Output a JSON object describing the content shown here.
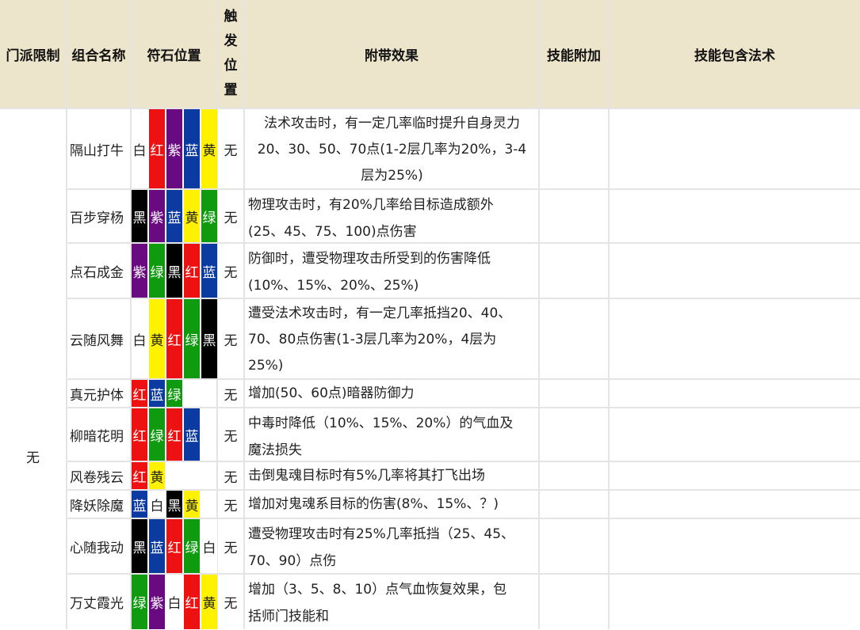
{
  "headers": {
    "school": "门派限制",
    "combo": "组合名称",
    "runes": "符石位置",
    "trigger": [
      "触",
      "发",
      "位",
      "置"
    ],
    "effect": "附带效果",
    "skill_add": "技能附加",
    "skill_spells": "技能包含法术"
  },
  "school_value": "无",
  "rune_colors": {
    "白": {
      "bg": "#ffffff",
      "fg": "#222222"
    },
    "红": {
      "bg": "#ee1111",
      "fg": "#ffffff"
    },
    "紫": {
      "bg": "#6a0a80",
      "fg": "#ffffff"
    },
    "蓝": {
      "bg": "#0b3aa0",
      "fg": "#ffffff"
    },
    "黄": {
      "bg": "#fff200",
      "fg": "#222222"
    },
    "黑": {
      "bg": "#000000",
      "fg": "#ffffff"
    },
    "绿": {
      "bg": "#109a10",
      "fg": "#ffffff"
    }
  },
  "rows": [
    {
      "name": "隔山打牛",
      "runes": [
        "白",
        "红",
        "紫",
        "蓝",
        "黄"
      ],
      "trigger": "无",
      "effect_lines": [
        "法术攻击时，有一定几率临时提升自身灵力",
        "20、30、50、70点(1-2层几率为20%，3-4",
        "层为25%)"
      ],
      "center": true
    },
    {
      "name": "百步穿杨",
      "runes": [
        "黑",
        "紫",
        "蓝",
        "黄",
        "绿"
      ],
      "trigger": "无",
      "effect_lines": [
        "物理攻击时，有20%几率给目标造成额外",
        "(25、45、75、100)点伤害"
      ]
    },
    {
      "name": "点石成金",
      "runes": [
        "紫",
        "绿",
        "黑",
        "红",
        "蓝"
      ],
      "trigger": "无",
      "effect_lines": [
        "防御时，遭受物理攻击所受到的伤害降低",
        "(10%、15%、20%、25%)"
      ]
    },
    {
      "name": "云随风舞",
      "runes": [
        "白",
        "黄",
        "红",
        "绿",
        "黑"
      ],
      "trigger": "无",
      "effect_lines": [
        "遭受法术攻击时，有一定几率抵挡20、40、",
        "70、80点伤害(1-3层几率为20%，4层为",
        "25%)"
      ]
    },
    {
      "name": "真元护体",
      "runes": [
        "红",
        "蓝",
        "绿"
      ],
      "trigger": "无",
      "effect_lines": [
        "增加(50、60点)暗器防御力"
      ]
    },
    {
      "name": "柳暗花明",
      "runes": [
        "红",
        "绿",
        "红",
        "蓝"
      ],
      "trigger": "无",
      "effect_lines": [
        "中毒时降低（10%、15%、20%）的气血及",
        "魔法损失"
      ]
    },
    {
      "name": "风卷残云",
      "runes": [
        "红",
        "黄"
      ],
      "trigger": "无",
      "effect_lines": [
        "击倒鬼魂目标时有5%几率将其打飞出场"
      ]
    },
    {
      "name": "降妖除魔",
      "runes": [
        "蓝",
        "白",
        "黑",
        "黄"
      ],
      "trigger": "无",
      "effect_lines": [
        "增加对鬼魂系目标的伤害(8%、15%、？)"
      ]
    },
    {
      "name": "心随我动",
      "runes": [
        "黑",
        "蓝",
        "红",
        "绿",
        "白"
      ],
      "trigger": "无",
      "effect_lines": [
        "遭受物理攻击时有25%几率抵挡（25、45、",
        "70、90）点伤"
      ]
    },
    {
      "name": "万丈霞光",
      "runes": [
        "绿",
        "紫",
        "白",
        "红",
        "黄"
      ],
      "trigger": "无",
      "effect_lines": [
        "增加（3、5、8、10）点气血恢复效果，包",
        "括师门技能和"
      ]
    }
  ]
}
